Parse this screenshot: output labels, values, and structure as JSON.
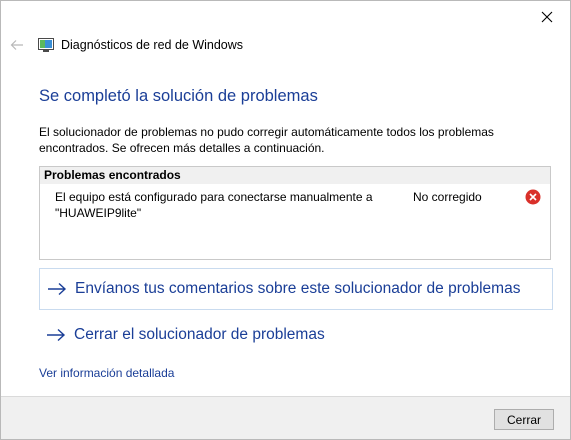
{
  "window": {
    "title": "Diagnósticos de red de Windows"
  },
  "main": {
    "heading": "Se completó la solución de problemas",
    "description": "El solucionador de problemas no pudo corregir automáticamente todos los problemas encontrados. Se ofrecen más detalles a continuación."
  },
  "problems": {
    "header": "Problemas encontrados",
    "items": [
      {
        "description": "El equipo está configurado para conectarse manualmente a \"HUAWEIP9lite\"",
        "status": "No corregido",
        "icon": "error-icon"
      }
    ]
  },
  "links": {
    "feedback": "Envíanos tus comentarios sobre este solucionador de problemas",
    "close_troubleshooter": "Cerrar el solucionador de problemas",
    "details": "Ver información detallada"
  },
  "footer": {
    "close_label": "Cerrar"
  },
  "colors": {
    "accent": "#1a3e97",
    "error": "#d9302a",
    "link_border": "#c9dbef"
  }
}
